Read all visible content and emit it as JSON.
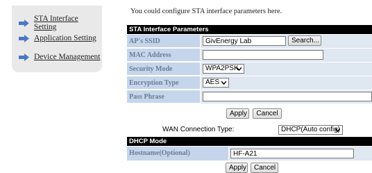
{
  "sidebar": {
    "items": [
      {
        "label": "STA Interface Setting",
        "icon": "arrow-right-icon"
      },
      {
        "label": "Application Setting",
        "icon": "arrow-right-icon"
      },
      {
        "label": "Device Management",
        "icon": "arrow-right-icon"
      }
    ]
  },
  "intro": "You could configure STA interface parameters here.",
  "sta_params": {
    "header": "STA Interface Parameters",
    "ssid_label": "AP's SSID",
    "ssid_value": "GivEnergy Lab",
    "search_label": "Search...",
    "mac_label": "MAC Address (Optional)",
    "mac_value": "",
    "security_label": "Security Mode",
    "security_value": "WPA2PSK",
    "encryption_label": "Encryption Type",
    "encryption_value": "AES",
    "passphrase_label": "Pass Phrase",
    "passphrase_value": ""
  },
  "buttons": {
    "apply": "Apply",
    "cancel": "Cancel"
  },
  "wan": {
    "label": "WAN Connection Type:",
    "value": "DHCP(Auto config)"
  },
  "dhcp": {
    "header": "DHCP Mode",
    "hostname_label": "Hostname(Optional)",
    "hostname_value": "HF-A21"
  },
  "colors": {
    "label_bg": "#c5d5eb",
    "value_bg": "#dfe7f1",
    "label_text": "#6b7c95",
    "header_bg": "#000000",
    "arrow": "#4a78c9"
  }
}
